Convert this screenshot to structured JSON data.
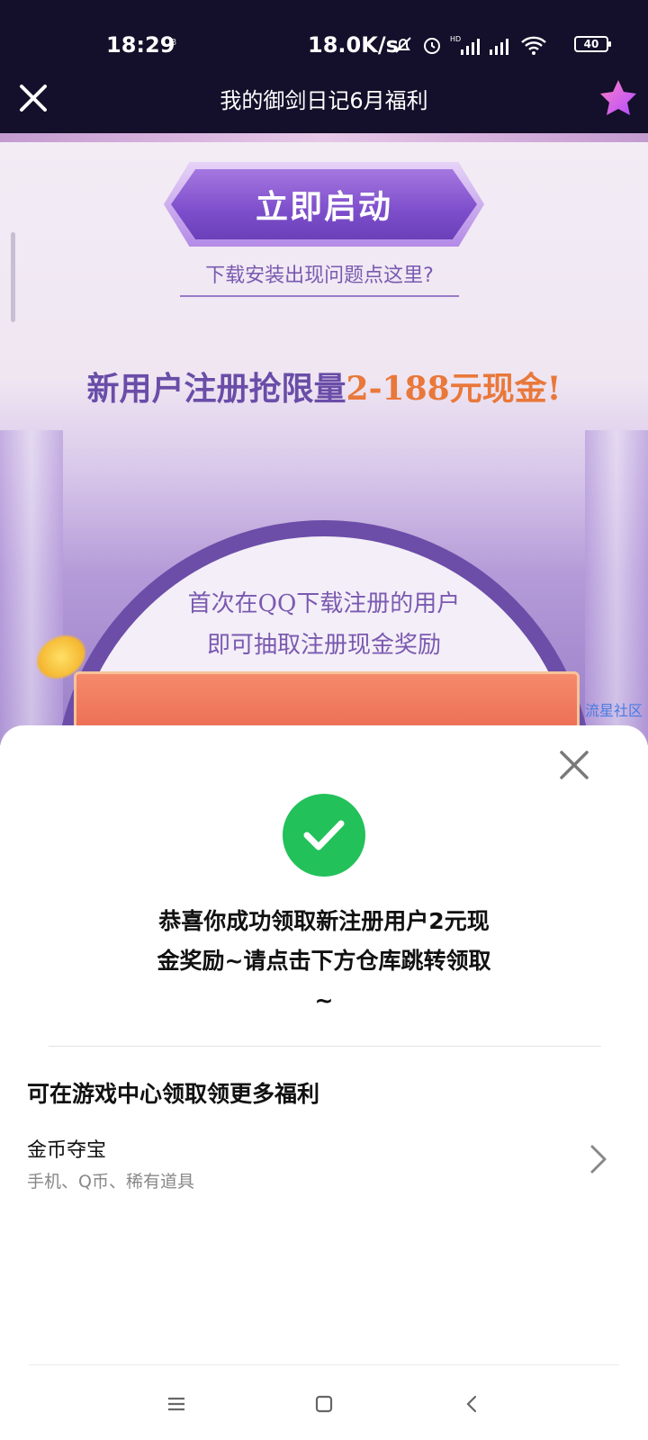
{
  "status_bar": {
    "time": "18:29",
    "small_indicator": "3",
    "net_speed": "18.0K/s",
    "battery": "40",
    "icons": [
      "mute-bell-icon",
      "alarm-icon",
      "hd-signal-icon",
      "signal-icon",
      "wifi-icon",
      "battery-icon"
    ]
  },
  "title_bar": {
    "title": "我的御剑日记6月福利",
    "close_icon": "close-icon",
    "right_icon": "star-icon"
  },
  "banner": {
    "start_button": "立即启动",
    "help_link": "下载安装出现问题点这里?",
    "promo_prefix": "新用户注册抢限量",
    "promo_amount": "2-188元现金!",
    "arch_line1": "首次在QQ下载注册的用户",
    "arch_line2": "即可抽取注册现金奖励",
    "watermark": "流星社区"
  },
  "sheet": {
    "success_line1": "恭喜你成功领取新注册用户2元现",
    "success_line2": "金奖励~请点击下方仓库跳转领取",
    "success_line3": "~",
    "more_heading": "可在游戏中心领取领更多福利",
    "item_title": "金币夺宝",
    "item_subtitle": "手机、Q币、稀有道具"
  },
  "colors": {
    "title_bar_bg": "#140f2a",
    "success_green": "#22c15a",
    "promo_purple": "#6a4da8",
    "promo_orange": "#e9783a"
  }
}
